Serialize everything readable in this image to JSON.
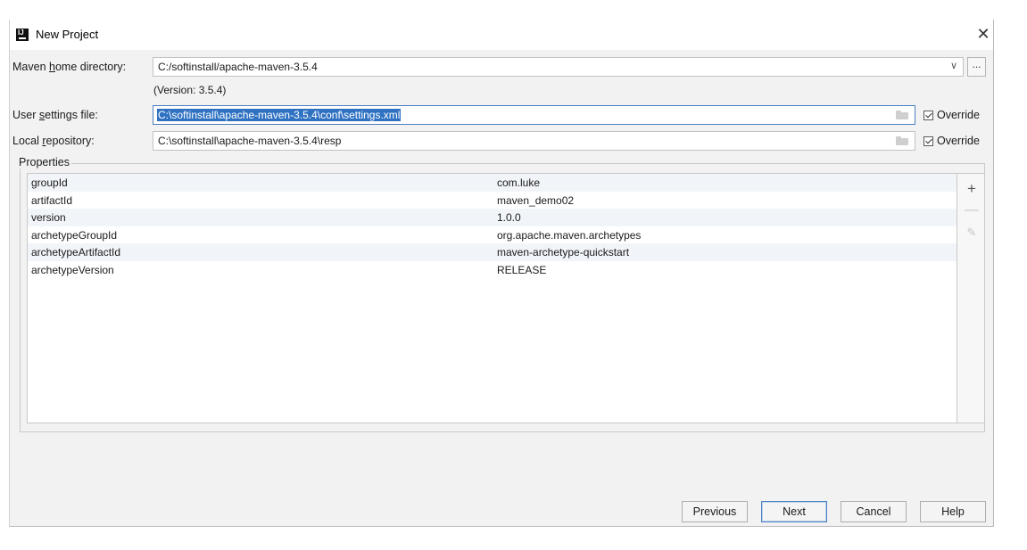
{
  "window": {
    "title": "New Project",
    "close_glyph": "✕",
    "icon": "intellij-icon",
    "icon_text": "IJ"
  },
  "maven_home": {
    "label_prefix": "Maven ",
    "label_mnemonic": "h",
    "label_suffix": "ome directory:",
    "value": "C:/softinstall/apache-maven-3.5.4",
    "dropdown_glyph": "∨",
    "browse_label": "...",
    "version_text": "(Version: 3.5.4)"
  },
  "user_settings": {
    "label_prefix": "User ",
    "label_mnemonic": "s",
    "label_suffix": "ettings file:",
    "value": "C:\\softinstall\\apache-maven-3.5.4\\conf\\settings.xml",
    "override_label": "Override",
    "override_checked": true
  },
  "local_repository": {
    "label_prefix": "Local ",
    "label_mnemonic": "r",
    "label_suffix": "epository:",
    "value": "C:\\softinstall\\apache-maven-3.5.4\\resp",
    "override_label": "Override",
    "override_checked": true
  },
  "properties": {
    "title": "Properties",
    "rows": [
      {
        "key": "groupId",
        "value": "com.luke"
      },
      {
        "key": "artifactId",
        "value": "maven_demo02"
      },
      {
        "key": "version",
        "value": "1.0.0"
      },
      {
        "key": "archetypeGroupId",
        "value": "org.apache.maven.archetypes"
      },
      {
        "key": "archetypeArtifactId",
        "value": "maven-archetype-quickstart"
      },
      {
        "key": "archetypeVersion",
        "value": "RELEASE"
      }
    ],
    "toolbar": {
      "add_glyph": "+",
      "remove_glyph": "—",
      "edit_glyph": "✎"
    }
  },
  "buttons": {
    "previous": "Previous",
    "next": "Next",
    "cancel": "Cancel",
    "help": "Help"
  },
  "colors": {
    "selection": "#2f72c2",
    "primary_border": "#4a7fc1",
    "dialog_bg": "#f2f2f2"
  }
}
